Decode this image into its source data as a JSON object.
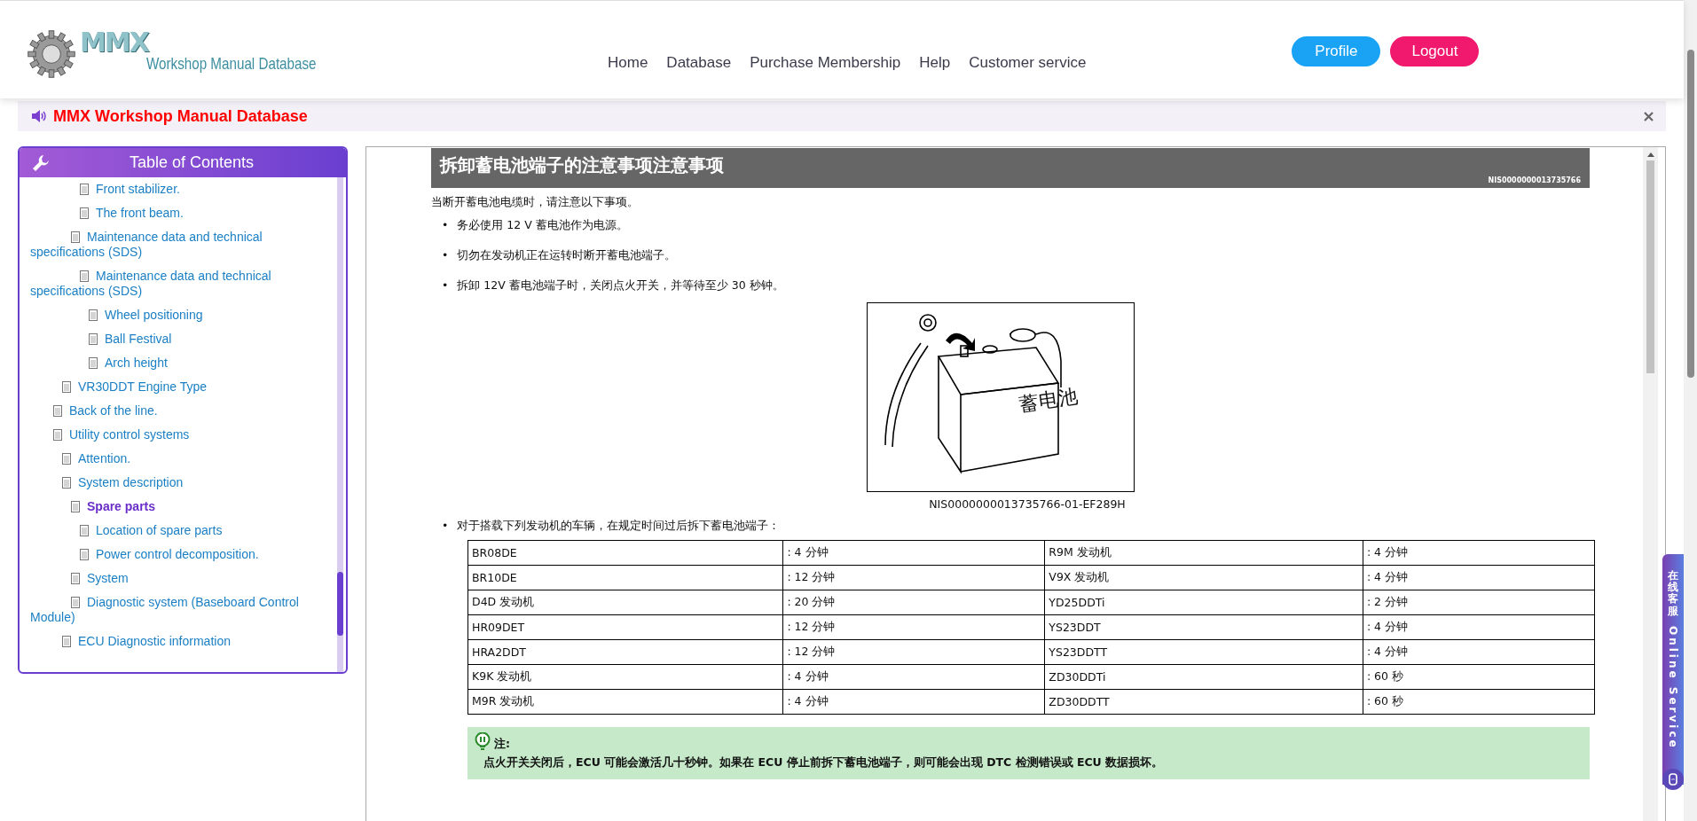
{
  "header": {
    "logo": {
      "mark": "MMX",
      "text": "Workshop Manual Database"
    },
    "nav": [
      {
        "label": "Home"
      },
      {
        "label": "Database"
      },
      {
        "label": "Purchase Membership"
      },
      {
        "label": "Help"
      },
      {
        "label": "Customer service"
      }
    ],
    "buttons": [
      {
        "label": "Profile",
        "kind": "profile"
      },
      {
        "label": "Logout",
        "kind": "logout"
      }
    ]
  },
  "notice": {
    "title": "MMX Workshop Manual Database"
  },
  "sidebar": {
    "title": "Table of Contents",
    "items": [
      {
        "children": [
          {
            "children": [
              {
                "children": [
                  {
                    "label": "Front stabilizer.",
                    "selected": false
                  },
                  {
                    "label": "The front beam.",
                    "selected": false
                  }
                ]
              },
              {
                "label": "Maintenance data and technical specifications (SDS)",
                "selected": false,
                "children": [
                  {
                    "label": "Maintenance data and technical specifications (SDS)",
                    "selected": false,
                    "children": [
                      {
                        "label": "Wheel positioning",
                        "selected": false
                      },
                      {
                        "label": "Ball Festival",
                        "selected": false
                      },
                      {
                        "label": "Arch height",
                        "selected": false
                      }
                    ]
                  }
                ]
              }
            ]
          },
          {
            "label": "VR30DDT Engine Type",
            "selected": false
          }
        ]
      },
      {
        "label": "Back of the line.",
        "selected": false
      },
      {
        "label": "Utility control systems",
        "selected": false,
        "children": [
          {
            "label": "Attention.",
            "selected": false
          },
          {
            "label": "System description",
            "selected": false,
            "children": [
              {
                "label": "Spare parts",
                "selected": true,
                "children": [
                  {
                    "label": "Location of spare parts",
                    "selected": false
                  },
                  {
                    "label": "Power control decomposition.",
                    "selected": false
                  }
                ]
              },
              {
                "label": "System",
                "selected": false
              },
              {
                "label": "Diagnostic system (Baseboard Control Module)",
                "selected": false
              }
            ]
          },
          {
            "label": "ECU Diagnostic information",
            "selected": false
          }
        ]
      }
    ]
  },
  "article": {
    "title": "拆卸蓄电池端子的注意事项注意事项",
    "doc_id": "NIS0000000013735766",
    "intro": "当断开蓄电池电缆时，请注意以下事项。",
    "bullet_marker": "•",
    "bullets": [
      "务必使用 12 V 蓄电池作为电源。",
      "切勿在发动机正在运转时断开蓄电池端子。",
      "拆卸 12V 蓄电池端子时，关闭点火开关，并等待至少 30 秒钟。"
    ],
    "figure": {
      "label": "蓄电池",
      "caption": "NIS0000000013735766-01-EF289H"
    },
    "table_intro": "对于搭载下列发动机的车辆，在规定时间过后拆下蓄电池端子：",
    "table": {
      "rows": [
        [
          "BR08DE",
          ": 4 分钟",
          "R9M 发动机",
          ": 4 分钟"
        ],
        [
          "BR10DE",
          ": 12 分钟",
          "V9X 发动机",
          ": 4 分钟"
        ],
        [
          "D4D 发动机",
          ": 20 分钟",
          "YD25DDTi",
          ": 2 分钟"
        ],
        [
          "HR09DET",
          ": 12 分钟",
          "YS23DDT",
          ": 4 分钟"
        ],
        [
          "HRA2DDT",
          ": 12 分钟",
          "YS23DDTT",
          ": 4 分钟"
        ],
        [
          "K9K 发动机",
          ": 4 分钟",
          "ZD30DDTi",
          ": 60 秒"
        ],
        [
          "M9R 发动机",
          ": 4 分钟",
          "ZD30DDTT",
          ": 60 秒"
        ]
      ]
    },
    "note": {
      "heading": "注:",
      "text": "点火开关关闭后，ECU 可能会激活几十秒钟。如果在 ECU 停止前拆下蓄电池端子，则可能会出现 DTC 检测错误或 ECU 数据损坏。"
    }
  },
  "online_service": {
    "chinese": "在线客服",
    "english": "Online Service"
  }
}
